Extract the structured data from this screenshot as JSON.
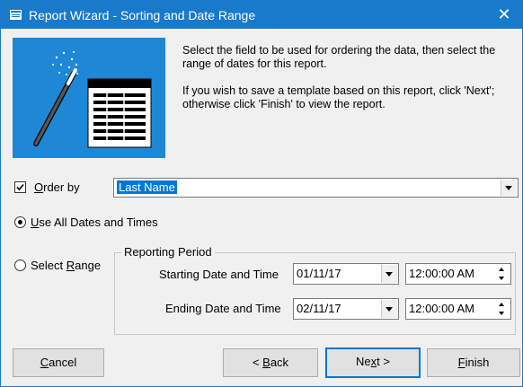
{
  "window": {
    "title": "Report Wizard - Sorting and Date Range",
    "close_glyph": "✕"
  },
  "instructions": {
    "line1": "Select the field to be used for ordering the data, then select the range of dates for this report.",
    "line2": "If you wish to save a template based on this report, click 'Next'; otherwise click 'Finish' to view the report."
  },
  "order_by": {
    "label": "Order by",
    "mnemonic": "O",
    "label_rest": "rder by",
    "checked": true,
    "value": "Last Name"
  },
  "date_mode": {
    "use_all": {
      "mnemonic": "U",
      "rest": "se All Dates and Times",
      "selected": true
    },
    "select_range": {
      "prefix": "Select ",
      "mnemonic": "R",
      "rest": "ange",
      "selected": false
    }
  },
  "reporting_period": {
    "title": "Reporting Period",
    "start": {
      "label": "Starting Date and Time",
      "date": "01/11/17",
      "time": "12:00:00 AM"
    },
    "end": {
      "label": "Ending Date and Time",
      "date": "02/11/17",
      "time": "12:00:00 AM"
    }
  },
  "buttons": {
    "cancel": {
      "mnemonic": "C",
      "rest": "ancel"
    },
    "back": {
      "prefix": "< ",
      "mnemonic": "B",
      "rest": "ack"
    },
    "next": {
      "prefix": "Ne",
      "mnemonic": "x",
      "rest": "t >"
    },
    "finish": {
      "mnemonic": "F",
      "rest": "inish"
    }
  },
  "colors": {
    "titlebar": "#1979ca",
    "banner": "#1e87d6",
    "selection": "#0078d7"
  }
}
